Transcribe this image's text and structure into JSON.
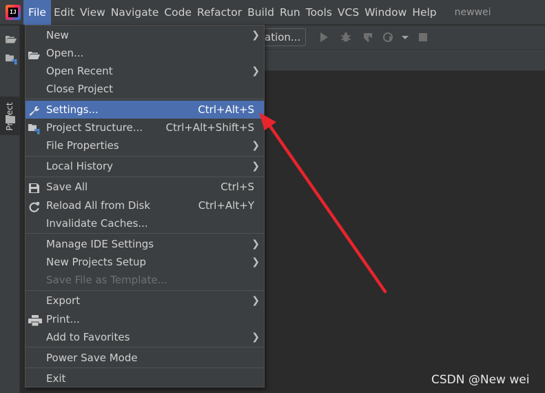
{
  "menubar": {
    "items": [
      "File",
      "Edit",
      "View",
      "Navigate",
      "Code",
      "Refactor",
      "Build",
      "Run",
      "Tools",
      "VCS",
      "Window",
      "Help"
    ],
    "project_name": "newwei"
  },
  "toolbar": {
    "run_config_label": "ation..."
  },
  "left_strip": {
    "project_tab_label": "Project"
  },
  "file_menu": {
    "items": [
      {
        "label": "New",
        "shortcut": "",
        "submenu": true,
        "icon": "",
        "disabled": false
      },
      {
        "label": "Open...",
        "shortcut": "",
        "submenu": false,
        "icon": "folder-open-icon",
        "disabled": false
      },
      {
        "label": "Open Recent",
        "shortcut": "",
        "submenu": true,
        "icon": "",
        "disabled": false
      },
      {
        "label": "Close Project",
        "shortcut": "",
        "submenu": false,
        "icon": "",
        "disabled": false
      },
      {
        "label": "Settings...",
        "shortcut": "Ctrl+Alt+S",
        "submenu": false,
        "icon": "wrench-icon",
        "disabled": false,
        "selected": true
      },
      {
        "label": "Project Structure...",
        "shortcut": "Ctrl+Alt+Shift+S",
        "submenu": false,
        "icon": "project-structure-icon",
        "disabled": false
      },
      {
        "label": "File Properties",
        "shortcut": "",
        "submenu": true,
        "icon": "",
        "disabled": false
      },
      {
        "label": "Local History",
        "shortcut": "",
        "submenu": true,
        "icon": "",
        "disabled": false
      },
      {
        "label": "Save All",
        "shortcut": "Ctrl+S",
        "submenu": false,
        "icon": "save-icon",
        "disabled": false
      },
      {
        "label": "Reload All from Disk",
        "shortcut": "Ctrl+Alt+Y",
        "submenu": false,
        "icon": "reload-icon",
        "disabled": false
      },
      {
        "label": "Invalidate Caches...",
        "shortcut": "",
        "submenu": false,
        "icon": "",
        "disabled": false
      },
      {
        "label": "Manage IDE Settings",
        "shortcut": "",
        "submenu": true,
        "icon": "",
        "disabled": false
      },
      {
        "label": "New Projects Setup",
        "shortcut": "",
        "submenu": true,
        "icon": "",
        "disabled": false
      },
      {
        "label": "Save File as Template...",
        "shortcut": "",
        "submenu": false,
        "icon": "",
        "disabled": true
      },
      {
        "label": "Export",
        "shortcut": "",
        "submenu": true,
        "icon": "",
        "disabled": false
      },
      {
        "label": "Print...",
        "shortcut": "",
        "submenu": false,
        "icon": "print-icon",
        "disabled": false
      },
      {
        "label": "Add to Favorites",
        "shortcut": "",
        "submenu": true,
        "icon": "",
        "disabled": false
      },
      {
        "label": "Power Save Mode",
        "shortcut": "",
        "submenu": false,
        "icon": "",
        "disabled": false
      },
      {
        "label": "Exit",
        "shortcut": "",
        "submenu": false,
        "icon": "",
        "disabled": false
      }
    ]
  },
  "watermark": {
    "text": "CSDN @New wei"
  },
  "colors": {
    "menubar_bg": "#3c3f41",
    "selection": "#4b6eaf",
    "editor_bg": "#2b2b2b",
    "annotation_arrow": "#e8242c"
  }
}
